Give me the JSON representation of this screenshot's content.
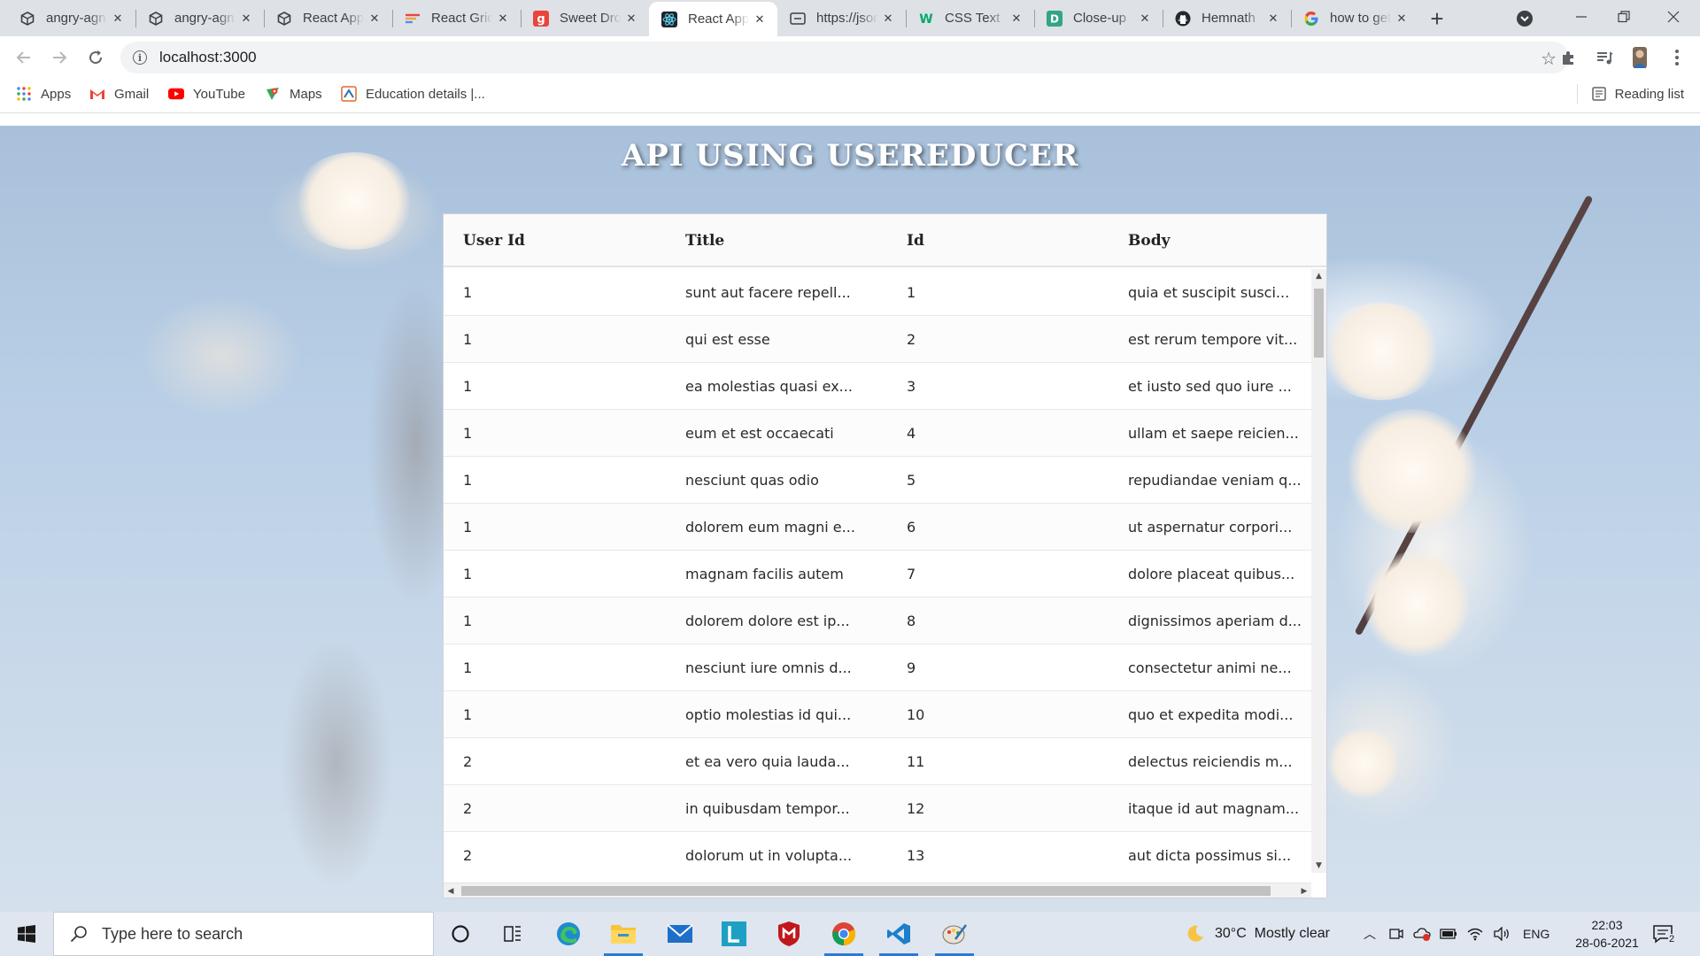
{
  "browser": {
    "tabs": [
      {
        "title": "angry-agn",
        "icon": "codesandbox-icon",
        "color": "#3c4043"
      },
      {
        "title": "angry-agn",
        "icon": "codesandbox-icon",
        "color": "#3c4043"
      },
      {
        "title": "React App",
        "icon": "codesandbox-icon",
        "color": "#3c4043"
      },
      {
        "title": "React Grid",
        "icon": "grid-logo-icon",
        "color": "#e8453c"
      },
      {
        "title": "Sweet Drop",
        "icon": "g-logo-icon",
        "color": "#e8453c"
      },
      {
        "title": "React App",
        "icon": "react-icon",
        "color": "#20232a",
        "active": true
      },
      {
        "title": "https://jsonplaceholder",
        "icon": "json-icon",
        "color": "#3c4043"
      },
      {
        "title": "CSS Text Shadow",
        "icon": "w3-icon",
        "color": "#04aa6d"
      },
      {
        "title": "Close-up",
        "icon": "d-logo-icon",
        "color": "#33a38a"
      },
      {
        "title": "Hemnath",
        "icon": "github-icon",
        "color": "#24292e"
      },
      {
        "title": "how to get",
        "icon": "google-icon",
        "color": "#4285f4"
      }
    ],
    "address": "localhost:3000",
    "bookmarks": [
      {
        "label": "Apps",
        "icon": "apps-grid-icon"
      },
      {
        "label": "Gmail",
        "icon": "gmail-icon"
      },
      {
        "label": "YouTube",
        "icon": "youtube-icon"
      },
      {
        "label": "Maps",
        "icon": "maps-icon"
      },
      {
        "label": "Education details |...",
        "icon": "edu-icon"
      }
    ],
    "reading_list": "Reading list"
  },
  "page": {
    "heading": "API USING USEREDUCER",
    "columns": [
      "User Id",
      "Title",
      "Id",
      "Body"
    ],
    "rows": [
      [
        "1",
        "sunt aut facere repell...",
        "1",
        "quia et suscipit susci..."
      ],
      [
        "1",
        "qui est esse",
        "2",
        "est rerum tempore vit..."
      ],
      [
        "1",
        "ea molestias quasi ex...",
        "3",
        "et iusto sed quo iure ..."
      ],
      [
        "1",
        "eum et est occaecati",
        "4",
        "ullam et saepe reicien..."
      ],
      [
        "1",
        "nesciunt quas odio",
        "5",
        "repudiandae veniam q..."
      ],
      [
        "1",
        "dolorem eum magni e...",
        "6",
        "ut aspernatur corpori..."
      ],
      [
        "1",
        "magnam facilis autem",
        "7",
        "dolore placeat quibus..."
      ],
      [
        "1",
        "dolorem dolore est ip...",
        "8",
        "dignissimos aperiam d..."
      ],
      [
        "1",
        "nesciunt iure omnis d...",
        "9",
        "consectetur animi ne..."
      ],
      [
        "1",
        "optio molestias id qui...",
        "10",
        "quo et expedita modi..."
      ],
      [
        "2",
        "et ea vero quia lauda...",
        "11",
        "delectus reiciendis m..."
      ],
      [
        "2",
        "in quibusdam tempor...",
        "12",
        "itaque id aut magnam..."
      ],
      [
        "2",
        "dolorum ut in volupta...",
        "13",
        "aut dicta possimus si..."
      ]
    ]
  },
  "taskbar": {
    "search_placeholder": "Type here to search",
    "apps": [
      "cortana-icon",
      "task-view-icon",
      "edge-icon",
      "file-explorer-icon",
      "mail-icon",
      "l-app-icon",
      "mcafee-icon",
      "chrome-icon",
      "vscode-icon",
      "paint-icon"
    ],
    "weather": "30°C  Mostly clear",
    "language": "ENG",
    "time": "22:03",
    "date": "28-06-2021",
    "notifications": "2"
  }
}
